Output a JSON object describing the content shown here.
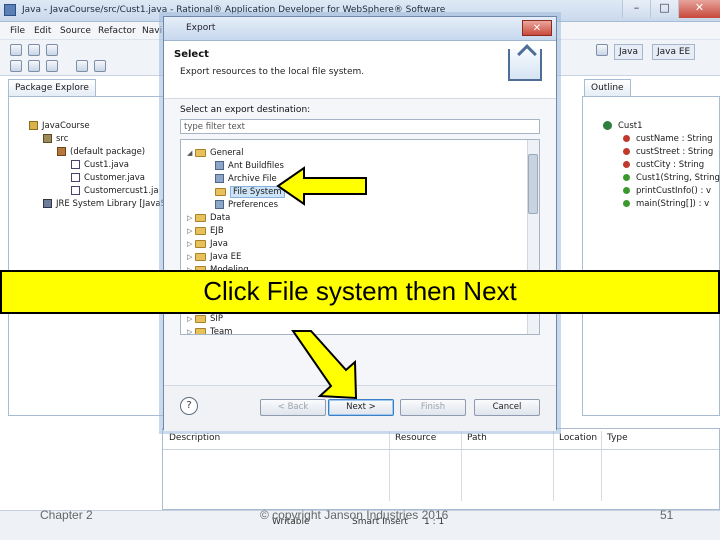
{
  "window": {
    "title": "Java - JavaCourse/src/Cust1.java - Rational® Application Developer for WebSphere® Software",
    "controls": {
      "minimize": "–",
      "maximize": "□",
      "close": "✕"
    }
  },
  "menu": [
    "File",
    "Edit",
    "Source",
    "Refactor",
    "Navi"
  ],
  "perspectives": [
    "Java",
    "Java EE"
  ],
  "package_explorer": {
    "tab": "Package Explore",
    "items": [
      "JavaCourse",
      "src",
      "(default package)",
      "Cust1.java",
      "Customer.java",
      "Customercust1.ja",
      "JRE System Library [JavaSE"
    ]
  },
  "outline": {
    "tab": "Outline",
    "items": [
      "Cust1",
      "custName : String",
      "custStreet : String",
      "custCity : String",
      "Cust1(String, String",
      "printCustInfo() : v",
      "main(String[]) : v"
    ]
  },
  "dialog": {
    "title": "Export",
    "close": "✕",
    "heading": "Select",
    "subheading": "Export resources to the local file system.",
    "destination_label": "Select an export destination:",
    "filter_value": "type filter text",
    "tree": {
      "general": "General",
      "general_children": [
        "Ant Buildfiles",
        "Archive File",
        "File System",
        "Preferences"
      ],
      "others": [
        "Data",
        "EJB",
        "Java",
        "Java EE",
        "Modeling",
        "SIP",
        "Team"
      ]
    },
    "buttons": {
      "help": "?",
      "back": "< Back",
      "next": "Next >",
      "finish": "Finish",
      "cancel": "Cancel"
    }
  },
  "problems": {
    "columns": [
      "Description",
      "Resource",
      "Path",
      "Location",
      "Type"
    ]
  },
  "statusbar": {
    "writable": "Writable",
    "insert": "Smart Insert",
    "position": "1 : 1"
  },
  "callout": {
    "text": "Click File system then Next",
    "color": "#ffff00"
  },
  "slide_footer": {
    "chapter": "Chapter 2",
    "copyright": "© copyright Janson Industries 2016",
    "page": "51"
  }
}
